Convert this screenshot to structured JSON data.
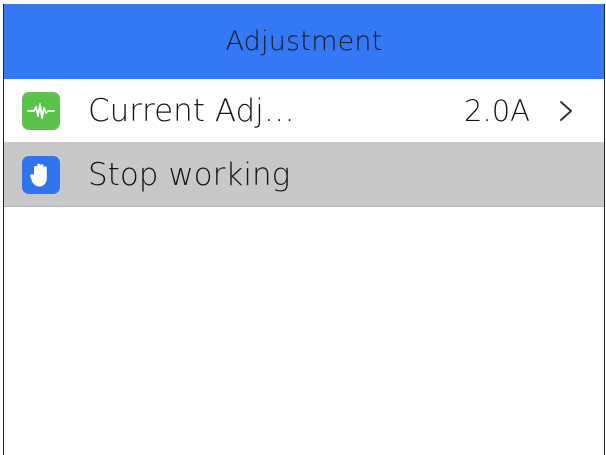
{
  "header": {
    "title": "Adjustment"
  },
  "menu": {
    "items": [
      {
        "label": "Current Adj…",
        "value": "2.0A",
        "icon": "waveform-icon",
        "icon_color": "#5bc24a",
        "selected": false
      },
      {
        "label": "Stop working",
        "value": "",
        "icon": "stop-hand-icon",
        "icon_color": "#2f74ee",
        "selected": true
      }
    ]
  },
  "colors": {
    "header_bg": "#3478f6",
    "selected_row_bg": "#c8c8c8",
    "background": "#ffffff"
  }
}
